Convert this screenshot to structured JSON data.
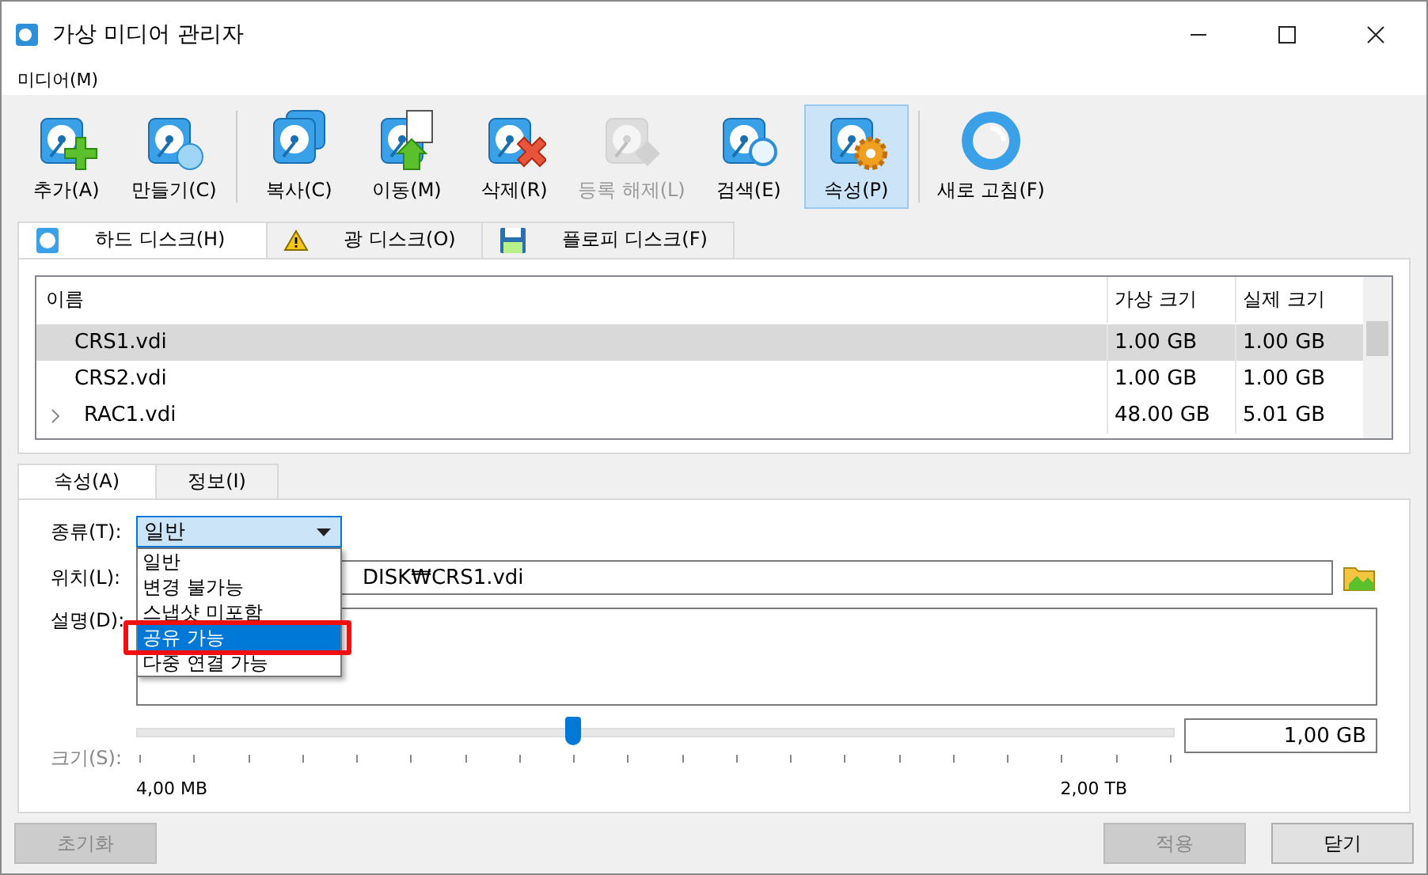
{
  "window": {
    "title": "가상 미디어 관리자"
  },
  "menu": [
    "미디어(M)"
  ],
  "toolbar": [
    {
      "label": "추가(A)",
      "kind": "add",
      "disabled": false,
      "selected": false
    },
    {
      "label": "만들기(C)",
      "kind": "create",
      "disabled": false,
      "selected": false
    },
    {
      "label": "복사(C)",
      "kind": "copy",
      "disabled": false,
      "selected": false
    },
    {
      "label": "이동(M)",
      "kind": "move",
      "disabled": false,
      "selected": false
    },
    {
      "label": "삭제(R)",
      "kind": "remove",
      "disabled": false,
      "selected": false
    },
    {
      "label": "등록 해제(L)",
      "kind": "release",
      "disabled": true,
      "selected": false
    },
    {
      "label": "검색(E)",
      "kind": "search",
      "disabled": false,
      "selected": false
    },
    {
      "label": "속성(P)",
      "kind": "properties",
      "disabled": false,
      "selected": true
    },
    {
      "label": "새로 고침(F)",
      "kind": "refresh",
      "disabled": false,
      "selected": false
    }
  ],
  "tabs": [
    {
      "label": "하드 디스크(H)",
      "kind": "hdd",
      "selected": true
    },
    {
      "label": "광 디스크(O)",
      "kind": "optical",
      "selected": false
    },
    {
      "label": "플로피 디스크(F)",
      "kind": "floppy",
      "selected": false
    }
  ],
  "table": {
    "columns": [
      "이름",
      "가상 크기",
      "실제 크기"
    ],
    "rows": [
      {
        "name": "CRS1.vdi",
        "virtual": "1.00 GB",
        "actual": "1.00 GB",
        "selected": true,
        "expandable": false
      },
      {
        "name": "CRS2.vdi",
        "virtual": "1.00 GB",
        "actual": "1.00 GB",
        "selected": false,
        "expandable": false
      },
      {
        "name": "RAC1.vdi",
        "virtual": "48.00 GB",
        "actual": "5.01 GB",
        "selected": false,
        "expandable": true
      }
    ]
  },
  "detail_tabs": [
    {
      "label": "속성(A)",
      "selected": true
    },
    {
      "label": "정보(I)",
      "selected": false
    }
  ],
  "properties": {
    "type_label": "종류(T):",
    "type_value": "일반",
    "type_options": [
      {
        "label": "일반",
        "selected": false
      },
      {
        "label": "변경 불가능",
        "selected": false
      },
      {
        "label": "스냅샷 미포함",
        "selected": false
      },
      {
        "label": "공유 가능",
        "selected": true
      },
      {
        "label": "다중 연결 가능",
        "selected": false
      }
    ],
    "location_label": "위치(L):",
    "location_value": "DISK₩CRS1.vdi",
    "description_label": "설명(D):",
    "size_label": "크기(S):",
    "size_slider": {
      "level": 0.42
    },
    "size_value": "1,00 GB",
    "size_min": "4,00 MB",
    "size_max": "2,00 TB"
  },
  "buttons": {
    "reset": "초기화",
    "apply": "적용",
    "close": "닫기"
  }
}
